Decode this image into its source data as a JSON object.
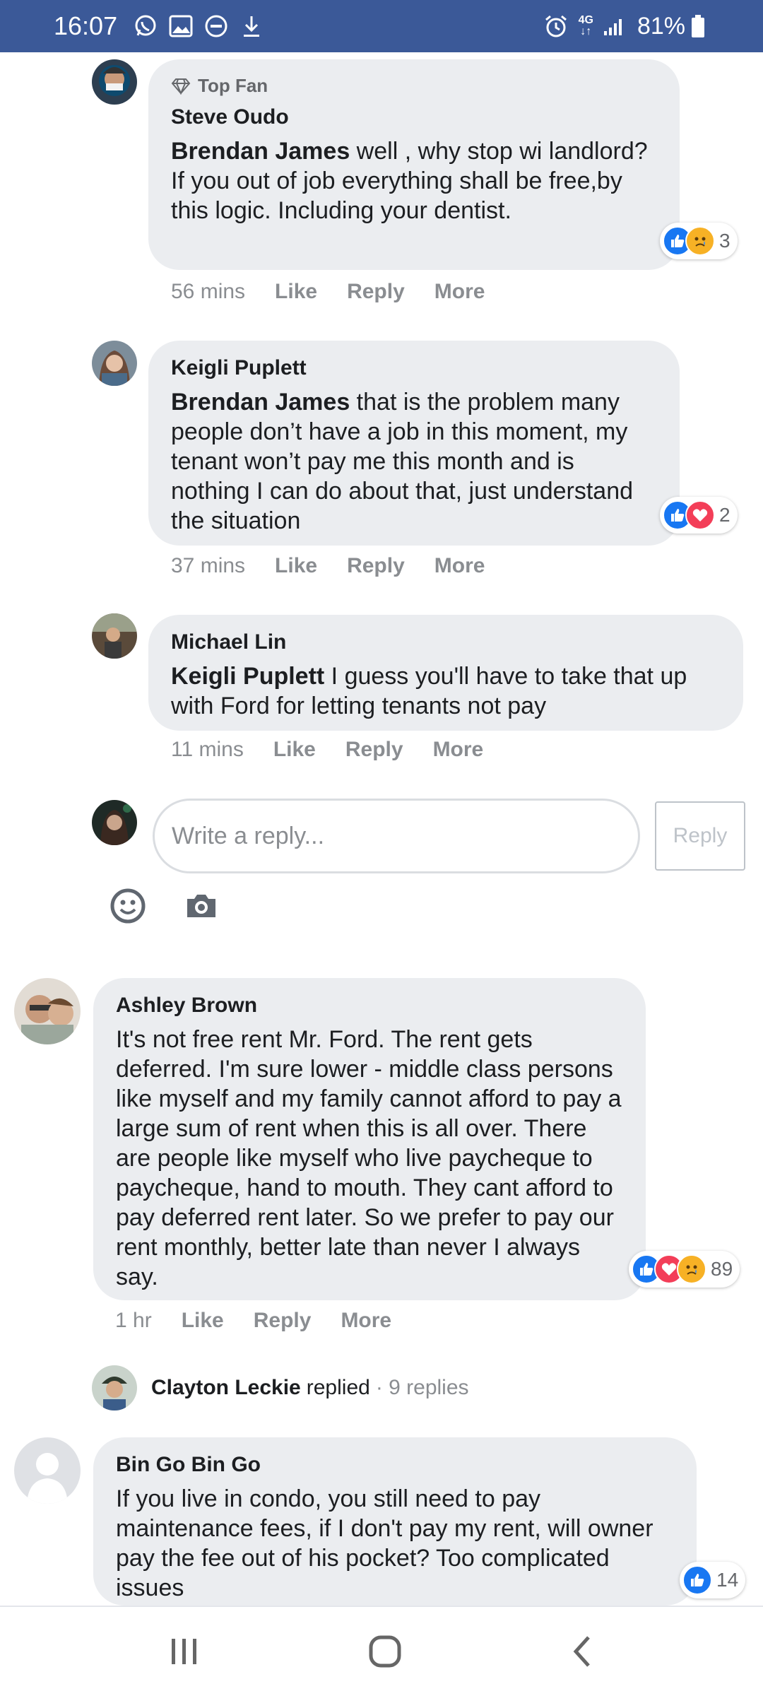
{
  "status_bar": {
    "time": "16:07",
    "network": "4G",
    "battery": "81%",
    "left_icons": [
      "whatsapp-icon",
      "gallery-icon",
      "dnd-icon",
      "download-icon"
    ],
    "right_icons": [
      "alarm-icon",
      "signal-icon",
      "battery-icon"
    ]
  },
  "comments": [
    {
      "badge": "Top Fan",
      "author": "Steve Oudo",
      "mention": "Brendan James",
      "text": " well , why stop wi landlord? If you out of job everything shall be free,by this logic. Including your dentist.",
      "reaction_count": "3",
      "reactions": [
        "like",
        "sad"
      ],
      "time": "56 mins",
      "like": "Like",
      "reply": "Reply",
      "more": "More"
    },
    {
      "author": "Keigli Puplett",
      "mention": "Brendan James",
      "text": " that is the problem many people don’t have a job in this moment, my tenant won’t pay me this month and is nothing I can do about that, just understand the situation",
      "reaction_count": "2",
      "reactions": [
        "like",
        "love"
      ],
      "time": "37 mins",
      "like": "Like",
      "reply": "Reply",
      "more": "More"
    },
    {
      "author": "Michael Lin",
      "mention": "Keigli Puplett",
      "text": " I guess you'll have to take that up with Ford for letting tenants not pay",
      "time": "11 mins",
      "like": "Like",
      "reply": "Reply",
      "more": "More"
    },
    {
      "author": "Ashley Brown",
      "text": "It's not free rent Mr. Ford. The rent gets deferred. I'm sure lower - middle class persons like myself and my family cannot afford to pay a large sum of rent when this is all over. There are people like myself who live paycheque to paycheque, hand to mouth. They cant afford to pay deferred rent later. So we prefer to pay our rent monthly, better late than never I always say.",
      "reaction_count": "89",
      "reactions": [
        "like",
        "love",
        "sad"
      ],
      "time": "1 hr",
      "like": "Like",
      "reply": "Reply",
      "more": "More"
    },
    {
      "author": "Bin Go Bin Go",
      "text": "If you live in condo, you still need to pay maintenance fees, if I don't pay my rent, will owner pay the fee out of his pocket? Too complicated issues",
      "reaction_count": "14",
      "reactions": [
        "like"
      ]
    }
  ],
  "composer": {
    "placeholder": "Write a reply...",
    "button": "Reply"
  },
  "replied": {
    "name": "Clayton Leckie",
    "text": "replied",
    "count": "· 9 replies"
  },
  "colors": {
    "status_bar": "#3b5998",
    "bubble": "#ebedf0",
    "like": "#1877f2",
    "love": "#f33e58",
    "sad": "#f7b125",
    "meta_text": "#8a8d91"
  }
}
